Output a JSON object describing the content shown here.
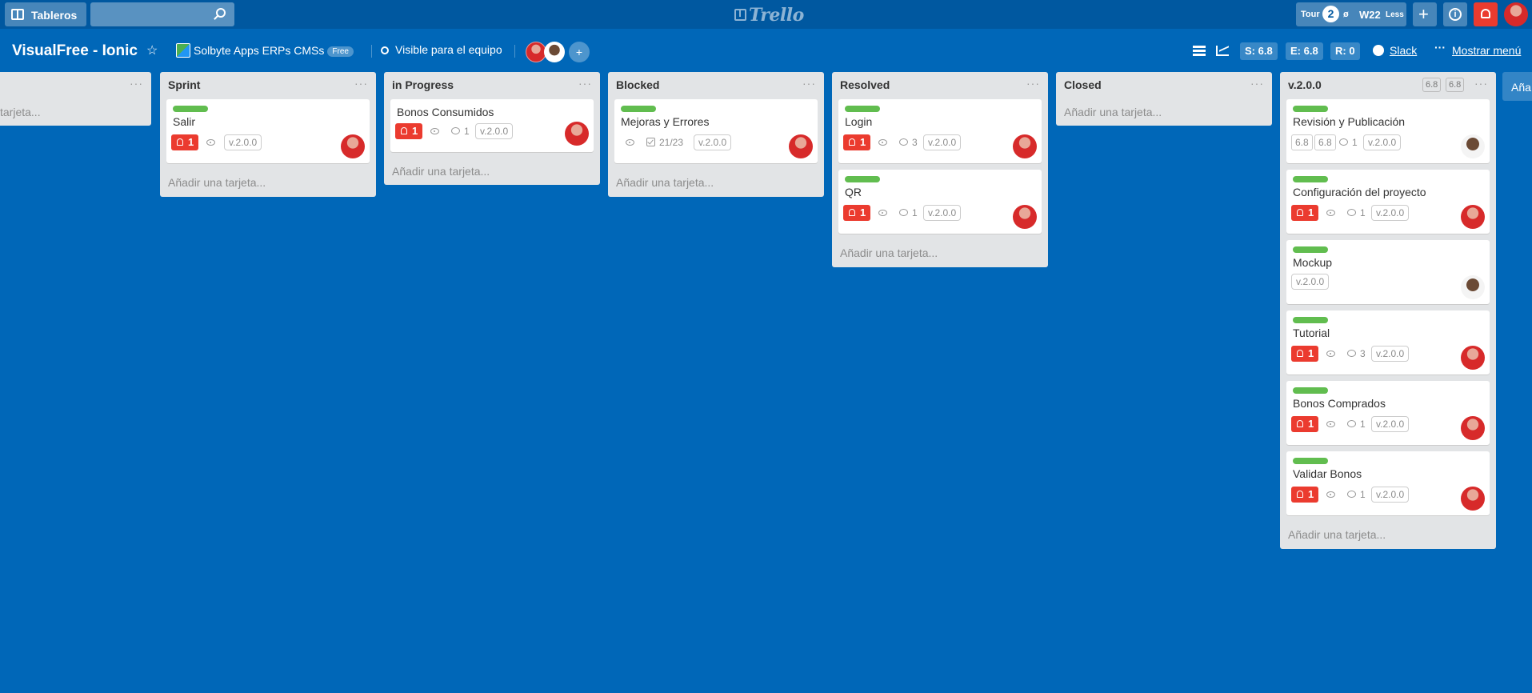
{
  "topbar": {
    "boards_label": "Tableros",
    "search_placeholder": "",
    "logo_text": "Trello",
    "tour_label": "Tour",
    "tour_count": "2",
    "tour_symbol": "ø",
    "week_label": "W22",
    "less_label": "Less",
    "plus_symbol": "+",
    "info_symbol": "i"
  },
  "board": {
    "title": "VisualFree - Ionic",
    "team_name": "Solbyte Apps ERPs CMSs",
    "team_plan": "Free",
    "visibility": "Visible para el equipo",
    "add_member_symbol": "+",
    "stats": {
      "s": "S: 6.8",
      "e": "E: 6.8",
      "r": "R: 0"
    },
    "slack_label": "Slack",
    "menu_dots": "···",
    "show_menu_label": "Mostrar menú"
  },
  "lists": {
    "first": {
      "add": "tarjeta...",
      "menu": "···"
    },
    "sprint": {
      "name": "Sprint",
      "menu": "···",
      "add": "Añadir una tarjeta...",
      "cards": [
        {
          "title": "Salir",
          "notif": "1",
          "version": "v.2.0.0"
        }
      ]
    },
    "inprogress": {
      "name": "in Progress",
      "menu": "···",
      "add": "Añadir una tarjeta...",
      "cards": [
        {
          "title": "Bonos Consumidos",
          "notif": "1",
          "comments": "1",
          "version": "v.2.0.0"
        }
      ]
    },
    "blocked": {
      "name": "Blocked",
      "menu": "···",
      "add": "Añadir una tarjeta...",
      "cards": [
        {
          "title": "Mejoras y Errores",
          "checklist": "21/23",
          "version": "v.2.0.0"
        }
      ]
    },
    "resolved": {
      "name": "Resolved",
      "menu": "···",
      "add": "Añadir una tarjeta...",
      "cards": [
        {
          "title": "Login",
          "notif": "1",
          "comments": "3",
          "version": "v.2.0.0"
        },
        {
          "title": "QR",
          "notif": "1",
          "comments": "1",
          "version": "v.2.0.0"
        }
      ]
    },
    "closed": {
      "name": "Closed",
      "menu": "···",
      "add": "Añadir una tarjeta..."
    },
    "v200": {
      "name": "v.2.0.0",
      "menu": "···",
      "badge1": "6.8",
      "badge2": "6.8",
      "add": "Añadir una tarjeta...",
      "cards": [
        {
          "title": "Revisión y Publicación",
          "score1": "6.8",
          "score2": "6.8",
          "comments": "1",
          "version": "v.2.0.0"
        },
        {
          "title": "Configuración del proyecto",
          "notif": "1",
          "comments": "1",
          "version": "v.2.0.0"
        },
        {
          "title": "Mockup",
          "version": "v.2.0.0"
        },
        {
          "title": "Tutorial",
          "notif": "1",
          "comments": "3",
          "version": "v.2.0.0"
        },
        {
          "title": "Bonos Comprados",
          "notif": "1",
          "comments": "1",
          "version": "v.2.0.0"
        },
        {
          "title": "Validar Bonos",
          "notif": "1",
          "comments": "1",
          "version": "v.2.0.0"
        }
      ]
    },
    "next": {
      "add": "Aña"
    }
  }
}
